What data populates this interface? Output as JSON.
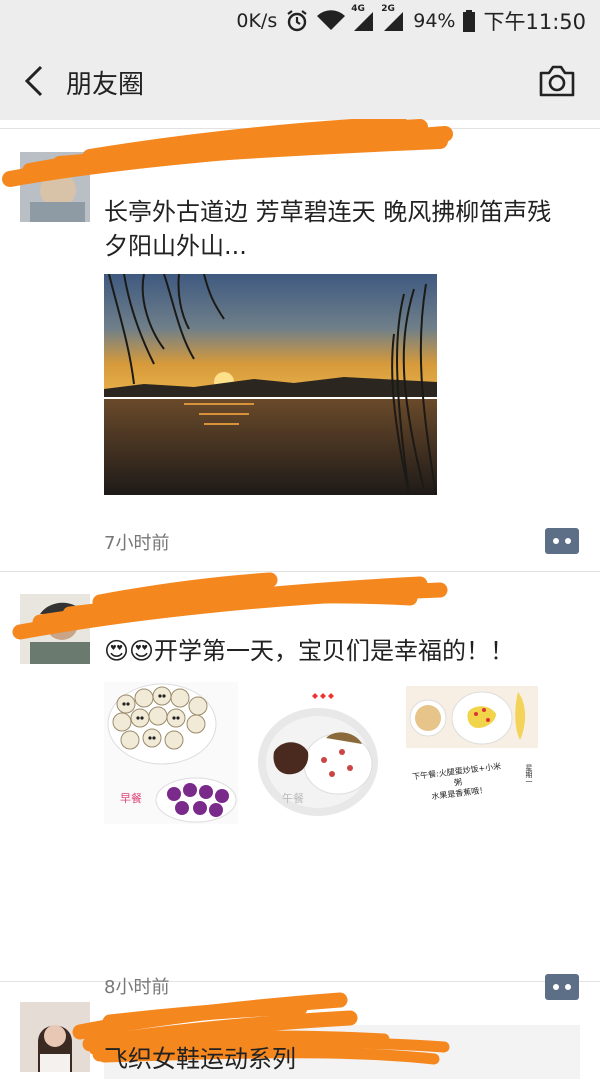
{
  "status_bar": {
    "net_speed": "0K/s",
    "lte": "4G",
    "g2": "2G",
    "battery": "94%",
    "time": "下午11:50",
    "icons": [
      "alarm-icon",
      "wifi-icon",
      "signal-icon",
      "signal-icon",
      "battery-icon"
    ]
  },
  "nav": {
    "title": "朋友圈",
    "back_icon": "back-icon",
    "camera_icon": "camera-icon"
  },
  "posts": [
    {
      "text": "长亭外古道边 芳草碧连天 晚风拂柳笛声残　  夕阳山外山...",
      "time": "7小时前"
    },
    {
      "text": "😍😍开学第一天，宝贝们是幸福的！！",
      "time": "8小时前",
      "image_labels": {
        "breakfast": "早餐",
        "lunch": "午餐",
        "dinner_line1": "下午餐:火腿蛋炒饭+小米",
        "dinner_line2": "粥",
        "dinner_line3": "水果是香蕉哦！",
        "dinner_side": "星期一"
      }
    },
    {
      "text": "飞织女鞋运动系列"
    }
  ],
  "colors": {
    "bar_bg": "#ededed",
    "scribble": "#f5871f",
    "more_button": "#5d6f86"
  }
}
